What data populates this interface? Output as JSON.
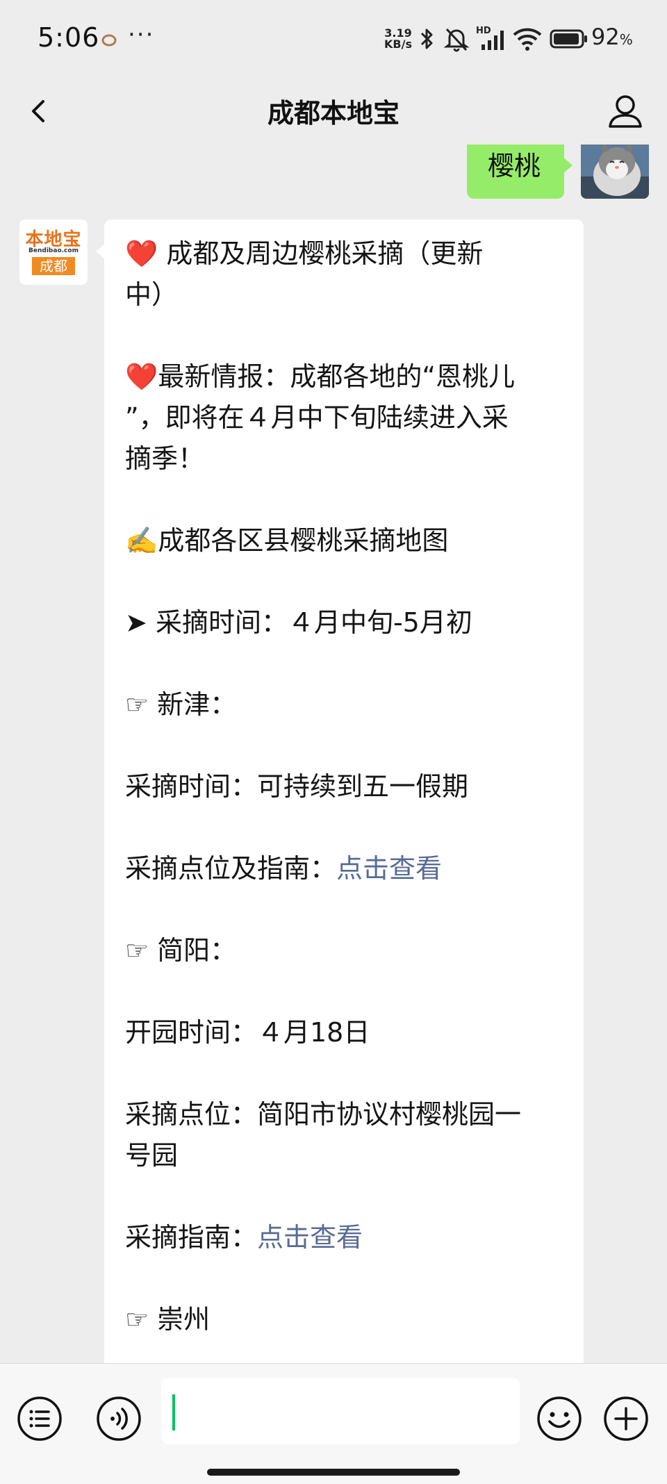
{
  "status_bar": {
    "time": "5:06",
    "more": "···",
    "net_speed_value": "3.19",
    "net_speed_unit": "KB/s",
    "battery": "92",
    "battery_unit": "%",
    "icons": [
      "notification-icon",
      "bluetooth-icon",
      "mute-icon",
      "hd-signal-icon",
      "wifi-icon",
      "battery-icon"
    ]
  },
  "header": {
    "title": "成都本地宝",
    "icons": [
      "chevron-left-icon",
      "person-icon"
    ]
  },
  "chat": {
    "outgoing": {
      "text": "樱桃"
    },
    "bot_avatar": {
      "logo_top": "本地宝",
      "logo_mid": "Bendibao.com",
      "logo_bottom": "成都"
    },
    "incoming": {
      "title_emoji": "❤️",
      "title_line1": "成都及周边樱桃采摘（更新",
      "title_line2": "中）",
      "news_emoji": "❤️",
      "news_line1": "最新情报：成都各地的“恩桃儿",
      "news_line2": "”，即将在４月中下旬陆续进入采",
      "news_line3": "摘季！",
      "map_emoji": "✍️",
      "map_text": "成都各区县樱桃采摘地图",
      "arrow": "➤",
      "season_text": "采摘时间：４月中旬-5月初",
      "point_icon": "☞",
      "xinjin_text": "新津：",
      "xinjin_time": "采摘时间：可持续到五一假期",
      "xinjin_guide_label": "采摘点位及指南：",
      "xinjin_guide_link": "点击查看",
      "jianyang_text": "简阳：",
      "jianyang_open": "开园时间：４月18日",
      "jianyang_spot_line1": "采摘点位：简阳市协议村樱桃园一",
      "jianyang_spot_line2": "号园",
      "jianyang_guide_label": "采摘指南：",
      "jianyang_guide_link": "点击查看",
      "chongzhou_text": "崇州"
    }
  },
  "input_bar": {
    "placeholder": "",
    "icons": [
      "list-icon",
      "voice-icon",
      "emoji-icon",
      "plus-icon"
    ]
  },
  "colors": {
    "background": "#ededed",
    "user_bubble": "#95ec69",
    "link": "#576b95",
    "cursor": "#07c160"
  }
}
